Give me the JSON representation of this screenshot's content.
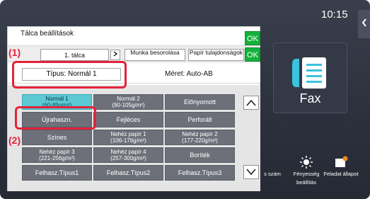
{
  "clock": "10:15",
  "dialog": {
    "title": "Tálca  beállítások",
    "ok_label": "OK",
    "tabs": [
      {
        "label": "1. tálca"
      },
      {
        "label": "Munka besorolása"
      },
      {
        "label": "Papír tulajdonságok"
      }
    ],
    "type_label": "Típus: Normál 1",
    "size_label": "Méret:  Auto-AB",
    "grid": [
      [
        {
          "line1": "Normál 1",
          "line2": "(60-89g/m²)"
        },
        {
          "line1": "Normál 2",
          "line2": "(90-105g/m²)"
        },
        {
          "line1": "Előnyomott",
          "line2": ""
        }
      ],
      [
        {
          "line1": "Újrahaszn.",
          "line2": ""
        },
        {
          "line1": "Fejléces",
          "line2": ""
        },
        {
          "line1": "Perforált",
          "line2": ""
        }
      ],
      [
        {
          "line1": "Színes",
          "line2": ""
        },
        {
          "line1": "Nehéz papír 1",
          "line2": "(106-176g/m²)"
        },
        {
          "line1": "Nehéz papír 2",
          "line2": "(177-220g/m²)"
        }
      ],
      [
        {
          "line1": "Nehéz papír 3",
          "line2": "(221-256g/m²)"
        },
        {
          "line1": "Nehéz papír 4",
          "line2": "(257-300g/m²)"
        },
        {
          "line1": "Boríték",
          "line2": ""
        }
      ],
      [
        {
          "line1": "Felhasz.Típus1",
          "line2": ""
        },
        {
          "line1": "Felhasz.Típus2",
          "line2": ""
        },
        {
          "line1": "Felhasz.Típus3",
          "line2": ""
        }
      ]
    ]
  },
  "callouts": {
    "one": "(1)",
    "two": "(2)"
  },
  "home": {
    "fax_label": "Fax",
    "bottom": [
      {
        "label": "s szám"
      },
      {
        "label": "Fényesség beállítás"
      },
      {
        "label": "Feladat állapot"
      }
    ],
    "footer_fragment": "Y"
  },
  "colors": {
    "ok": "#14b13b",
    "selected": "#5cc9d3",
    "callout": "#e4223a",
    "cell": "#6d7079"
  }
}
